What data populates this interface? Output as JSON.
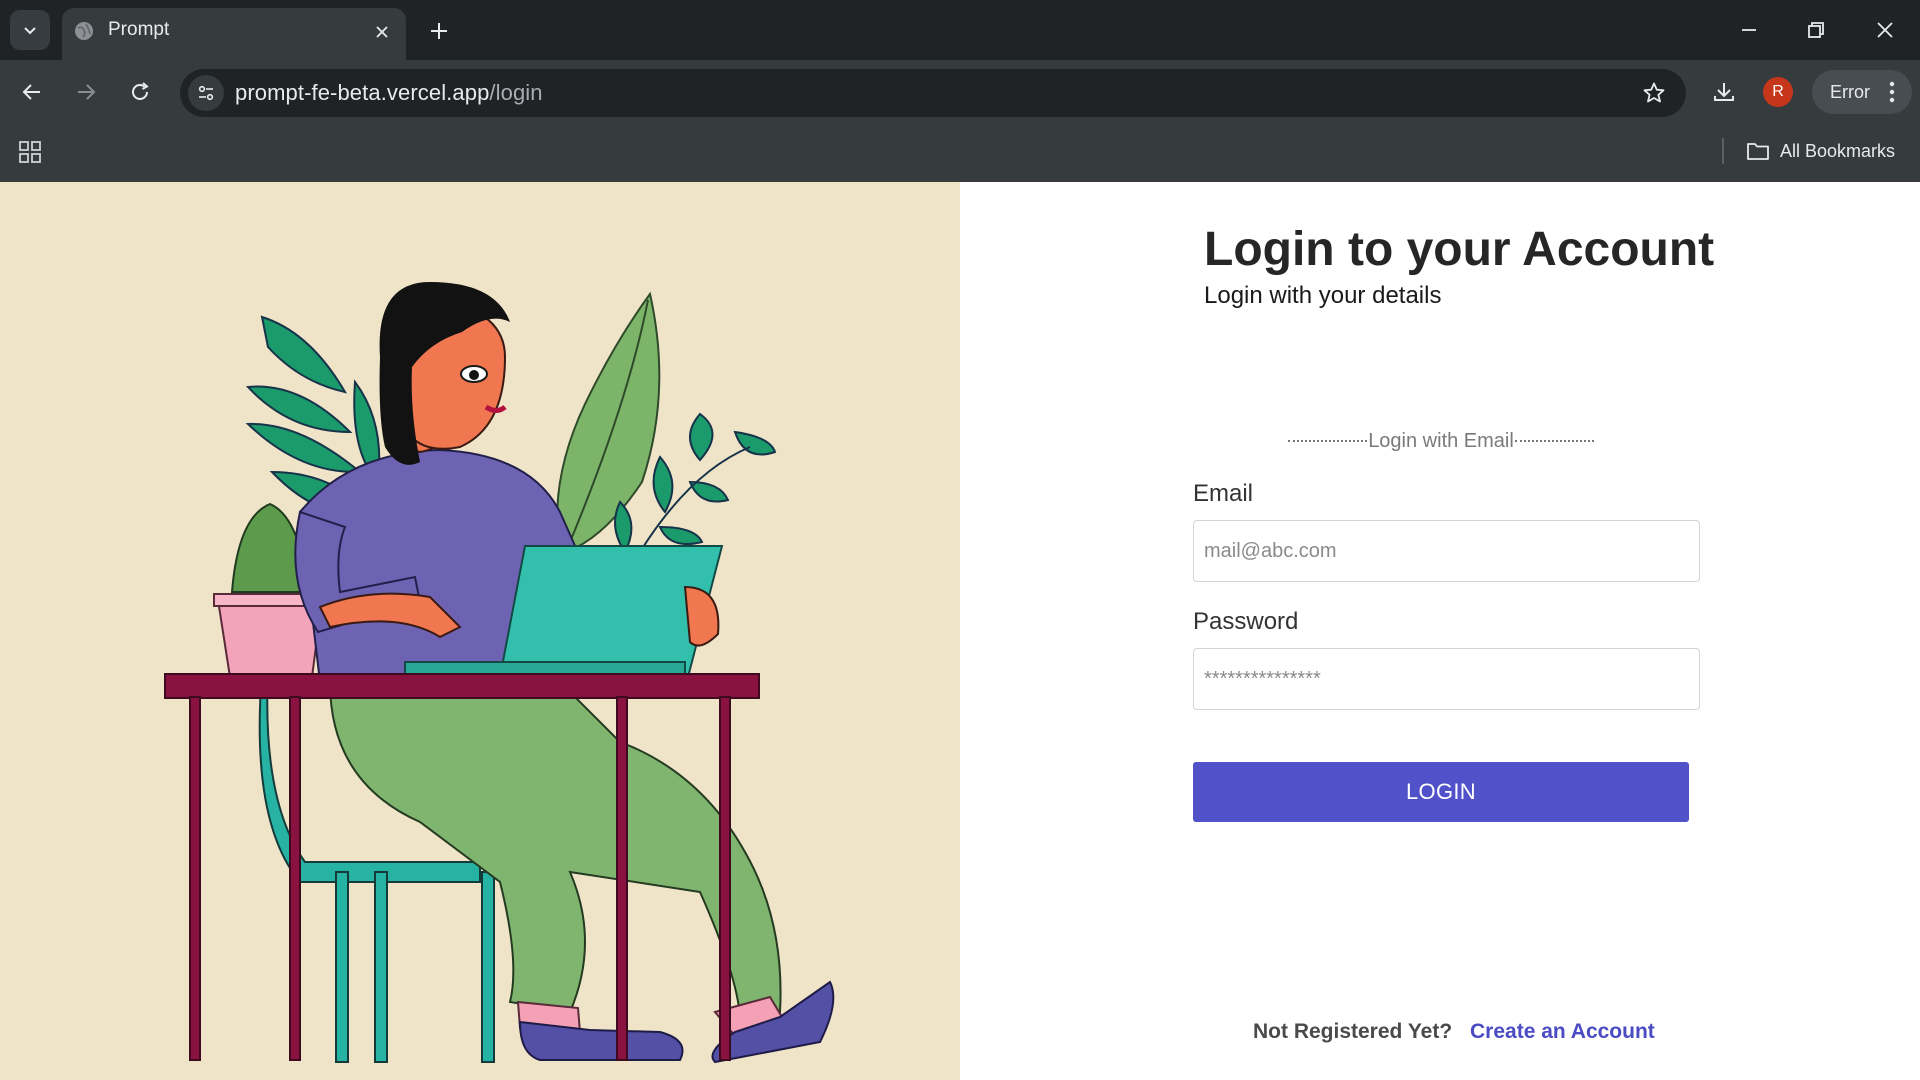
{
  "browser": {
    "tab": {
      "title": "Prompt"
    },
    "address_bar": {
      "host": "prompt-fe-beta.vercel.app",
      "path": "/login"
    },
    "profile": {
      "initial": "R"
    },
    "status_chip": "Error",
    "bookmarks": {
      "all_bookmarks_label": "All Bookmarks"
    }
  },
  "login": {
    "heading": "Login to your Account",
    "subheading": "Login with your details",
    "divider_text": "Login with Email",
    "email": {
      "label": "Email",
      "placeholder": "mail@abc.com"
    },
    "password": {
      "label": "Password",
      "placeholder": "***************"
    },
    "submit_label": "LOGIN",
    "register_prompt": "Not Registered Yet?",
    "register_link": "Create an Account"
  },
  "colors": {
    "accent": "#5151c9",
    "link": "#4b4bc4",
    "illustration_bg": "#f0e4c8",
    "chrome_dark": "#1f2326",
    "chrome_toolbar": "#363b3e"
  }
}
